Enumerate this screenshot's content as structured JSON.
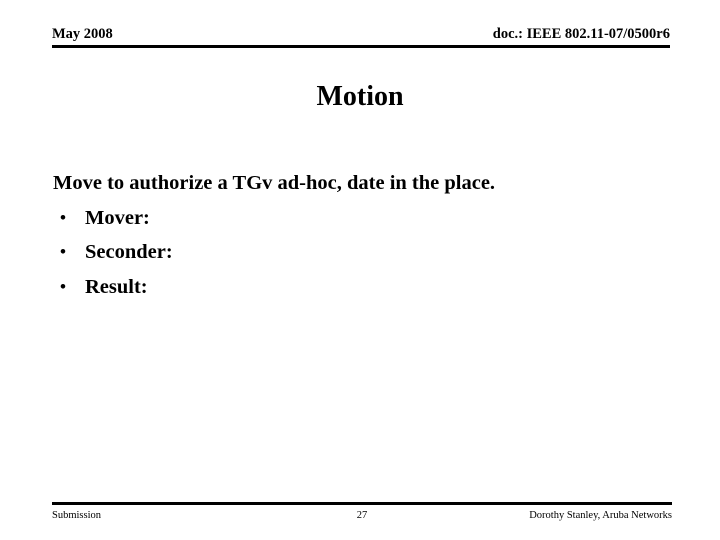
{
  "slide": {
    "header": {
      "date": "May 2008",
      "doc_reference": "doc.: IEEE 802.11-07/0500r6"
    },
    "title": "Motion",
    "body": {
      "intro": "Move to authorize a TGv ad-hoc, date in the place.",
      "bullet_glyph": "•",
      "bullets": [
        {
          "label": "Mover:"
        },
        {
          "label": "Seconder:"
        },
        {
          "label": "Result:"
        }
      ]
    },
    "footer": {
      "left": "Submission",
      "page_number": "27",
      "right": "Dorothy Stanley, Aruba Networks"
    },
    "colors": {
      "background": "#ffffff",
      "text": "#000000",
      "rule": "#000000"
    }
  }
}
